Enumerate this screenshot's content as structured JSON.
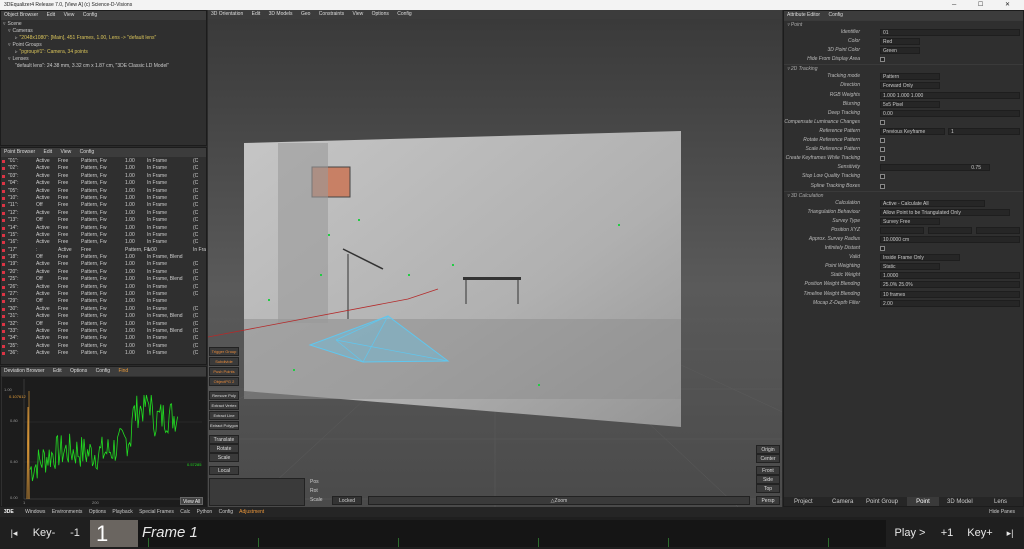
{
  "window": {
    "title": "3DEqualizer4 Release 7.0, [View A] (c) Science-D-Visions",
    "controls": "─ ☐ ✕"
  },
  "object_browser": {
    "menu": [
      "Object Browser",
      "Edit",
      "View",
      "Config"
    ],
    "scene_label": "Scene",
    "cameras_label": "Cameras",
    "camera_item": "\"2048x1080\": [Main], 451 Frames, 1.00, Lens -> \"default lens\"",
    "point_groups_label": "Point Groups",
    "pgroup_item": "\"pgroup#1\": Camera, 34 points",
    "lenses_label": "Lenses",
    "lens_item": "\"default lens\": 24.38 mm, 3.32 cm x 1.87 cm, \"3DE Classic LD Model\""
  },
  "point_browser": {
    "menu": [
      "Point Browser",
      "Edit",
      "View",
      "Config"
    ],
    "rows": [
      [
        "\"01\":",
        "Active",
        "Free",
        "Pattern, Fw",
        "1.00",
        "In Frame",
        "(C"
      ],
      [
        "\"02\":",
        "Active",
        "Free",
        "Pattern, Fw",
        "1.00",
        "In Frame",
        "(C"
      ],
      [
        "\"03\":",
        "Active",
        "Free",
        "Pattern, Fw",
        "1.00",
        "In Frame",
        "(C"
      ],
      [
        "\"04\":",
        "Active",
        "Free",
        "Pattern, Fw",
        "1.00",
        "In Frame",
        "(C"
      ],
      [
        "\"05\":",
        "Active",
        "Free",
        "Pattern, Fw",
        "1.00",
        "In Frame",
        "(C"
      ],
      [
        "\"10\":",
        "Active",
        "Free",
        "Pattern, Fw",
        "1.00",
        "In Frame",
        "(C"
      ],
      [
        "\"11\":",
        "Off",
        "Free",
        "Pattern, Fw",
        "1.00",
        "In Frame",
        "(C"
      ],
      [
        "\"12\":",
        "Active",
        "Free",
        "Pattern, Fw",
        "1.00",
        "In Frame",
        "(C"
      ],
      [
        "\"13\":",
        "Off",
        "Free",
        "Pattern, Fw",
        "1.00",
        "In Frame",
        "(C"
      ],
      [
        "\"14\":",
        "Active",
        "Free",
        "Pattern, Fw",
        "1.00",
        "In Frame",
        "(C"
      ],
      [
        "\"15\":",
        "Active",
        "Free",
        "Pattern, Fw",
        "1.00",
        "In Frame",
        "(C"
      ],
      [
        "\"16\":",
        "Active",
        "Free",
        "Pattern, Fw",
        "1.00",
        "In Frame",
        "(C"
      ],
      [
        "\"17\"",
        ":",
        "Active",
        "Free",
        "Pattern, Fw",
        "1.00",
        "In Frame",
        "(C"
      ],
      [
        "\"18\":",
        "Off",
        "Free",
        "Pattern, Fw",
        "1.00",
        "In Frame, Blend",
        ""
      ],
      [
        "\"19\":",
        "Active",
        "Free",
        "Pattern, Fw",
        "1.00",
        "In Frame",
        "(C"
      ],
      [
        "\"20\":",
        "Active",
        "Free",
        "Pattern, Fw",
        "1.00",
        "In Frame",
        "(C"
      ],
      [
        "\"25\":",
        "Off",
        "Free",
        "Pattern, Fw",
        "1.00",
        "In Frame, Blend",
        "(C"
      ],
      [
        "\"26\":",
        "Active",
        "Free",
        "Pattern, Fw",
        "1.00",
        "In Frame",
        "(C"
      ],
      [
        "\"27\":",
        "Active",
        "Free",
        "Pattern, Fw",
        "1.00",
        "In Frame",
        "(C"
      ],
      [
        "\"29\":",
        "Off",
        "Free",
        "Pattern, Fw",
        "1.00",
        "In Frame",
        ""
      ],
      [
        "\"30\":",
        "Active",
        "Free",
        "Pattern, Fw",
        "1.00",
        "In Frame",
        "(C"
      ],
      [
        "\"31\":",
        "Active",
        "Free",
        "Pattern, Fw",
        "1.00",
        "In Frame, Blend",
        "(C"
      ],
      [
        "\"32\":",
        "Off",
        "Free",
        "Pattern, Fw",
        "1.00",
        "In Frame",
        "(C"
      ],
      [
        "\"33\":",
        "Active",
        "Free",
        "Pattern, Fw",
        "1.00",
        "In Frame, Blend",
        "(C"
      ],
      [
        "\"34\":",
        "Active",
        "Free",
        "Pattern, Fw",
        "1.00",
        "In Frame",
        "(C"
      ],
      [
        "\"35\":",
        "Active",
        "Free",
        "Pattern, Fw",
        "1.00",
        "In Frame",
        "(C"
      ],
      [
        "\"36\":",
        "Active",
        "Free",
        "Pattern, Fw",
        "1.00",
        "In Frame",
        "(C"
      ]
    ]
  },
  "deviation_browser": {
    "menu": [
      "Deviation Browser",
      "Edit",
      "Options",
      "Config"
    ],
    "find_label": "Find",
    "y_ticks": [
      "1.00",
      "0.80",
      "0.40",
      "0.00"
    ],
    "corner_value": "0.107612",
    "x_ticks": [
      "1",
      "200"
    ],
    "right_value": "0.57285",
    "view_all": "View All"
  },
  "viewport": {
    "menu": [
      "3D Orientation",
      "Edit",
      "3D Models",
      "Geo",
      "Constraints",
      "View",
      "Options",
      "Config"
    ],
    "left_tools": [
      "Trigger Group",
      "Subdivide",
      "Push Points",
      "ObjectPG 2",
      "Remove Poly",
      "Extract Vertex",
      "Extract Line",
      "Extract Polygon"
    ],
    "transform_tools": [
      "Translate",
      "Rotate",
      "Scale"
    ],
    "local_label": "Local",
    "right_tools": [
      "Origin",
      "Center"
    ],
    "view_tools": [
      "Front",
      "Side",
      "Top"
    ],
    "persp_label": "Persp",
    "bottom_labels": [
      "Pos",
      "Rot",
      "Scale"
    ],
    "locked_label": "Locked",
    "zoom_label": "△Zoom"
  },
  "attribute_editor": {
    "menu": [
      "Attribute Editor",
      "Config"
    ],
    "point_section": "Point",
    "identifier_label": "Identifier",
    "identifier_value": "01",
    "color_label": "Color",
    "color_value": "Red",
    "point3d_color_label": "3D Point Color",
    "point3d_color_value": "Green",
    "hide_label": "Hide From Display Area",
    "tracking_section": "2D Tracking",
    "tracking_mode_label": "Tracking mode",
    "tracking_mode_value": "Pattern",
    "direction_label": "Direction",
    "direction_value": "Forward Only",
    "rgb_label": "RGB Weights",
    "rgb_value": "1.000 1.000 1.000",
    "blurring_label": "Blurring",
    "blurring_value": "5x5 Pixel",
    "deep_label": "Deep Tracking",
    "deep_value": "0.00",
    "comp_lum_label": "Compensate Luminance Changes",
    "ref_pattern_label": "Reference Pattern",
    "ref_pattern_value": "Previous Keyframe",
    "ref_pattern_num": "1",
    "rotate_ref_label": "Rotate Reference Pattern",
    "scale_ref_label": "Scale Reference Pattern",
    "create_kf_label": "Create Keyframes While Tracking",
    "sensitivity_label": "Sensitivity",
    "sensitivity_value": "0.75",
    "stop_low_label": "Stop Low Quality Tracking",
    "spline_label": "Spline Tracking Boxes",
    "calc_section": "3D Calculation",
    "calculation_label": "Calculation",
    "calculation_value": "Active - Calculate All",
    "triangulation_label": "Triangulation Behaviour",
    "triangulation_value": "Allow Point to be Triangulated Only",
    "survey_type_label": "Survey Type",
    "survey_type_value": "Survey Free",
    "position_label": "Position XYZ",
    "approx_label": "Approx. Survey Radius",
    "approx_value": "10.0000 cm",
    "inf_distant_label": "Infinitely Distant",
    "valid_label": "Valid",
    "valid_value": "Inside Frame Only",
    "weighting_label": "Point Weighting",
    "weighting_value": "Static",
    "static_weight_label": "Static Weight",
    "static_weight_value": "1.0000",
    "pos_blend_label": "Position Weight Blending",
    "pos_blend_value": "25.0%  25.0%",
    "timeline_blend_label": "Timeline Weight Blending",
    "timeline_blend_value": "10 frames",
    "mocap_label": "Mocap Z-Depth Filter",
    "mocap_value": "2.00",
    "tabs": [
      "Project",
      "Camera",
      "Point Group",
      "Point",
      "3D Model",
      "Lens"
    ]
  },
  "bottom_menu": {
    "logo": "3DE",
    "items": [
      "Windows",
      "Environments",
      "Options",
      "Playback",
      "Special Frames",
      "Calc",
      "Python",
      "Config"
    ],
    "adjustment": "Adjustment",
    "hide_panes": "Hide Panes"
  },
  "timeline": {
    "first_btn": "|◂",
    "key_minus": "Key-",
    "minus_one": "-1",
    "frame_number": "1",
    "frame_label": "Frame 1",
    "play": "Play >",
    "plus_one": "+1",
    "key_plus": "Key+",
    "last_btn": "▸|"
  },
  "colors": {
    "accent_orange": "#e8953a",
    "point_red": "#d33a44",
    "mesh_blue": "#5fc7ef",
    "graph_green": "#22dd22",
    "graph_orange": "#e8a03a"
  }
}
